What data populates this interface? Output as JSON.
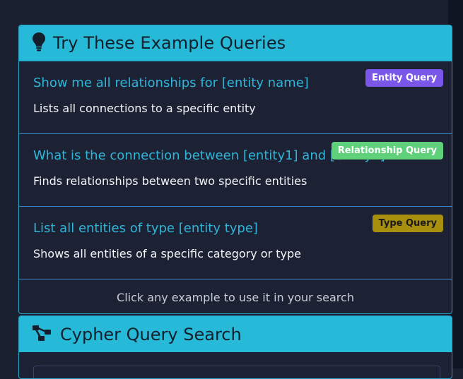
{
  "examples_card": {
    "title": "Try These Example Queries",
    "icon": "lightbulb-icon",
    "items": [
      {
        "query": "Show me all relationships for [entity name]",
        "description": "Lists all connections to a specific entity",
        "badge": "Entity Query",
        "badge_bg": "#7a57e8",
        "badge_fg": "#ffffff"
      },
      {
        "query": "What is the connection between [entity1] and [entity2]?",
        "description": "Finds relationships between two specific entities",
        "badge": "Relationship Query",
        "badge_bg": "#5fd17a",
        "badge_fg": "#ffffff"
      },
      {
        "query": "List all entities of type [entity type]",
        "description": "Shows all entities of a specific category or type",
        "badge": "Type Query",
        "badge_bg": "#a8900e",
        "badge_fg": "#1a1a1a"
      }
    ],
    "footer": "Click any example to use it in your search"
  },
  "cypher_card": {
    "title": "Cypher Query Search",
    "icon": "graph-nodes-icon"
  },
  "colors": {
    "header_bg": "#27b9d8",
    "link": "#2fb5d8",
    "page_bg": "#1b2031"
  }
}
